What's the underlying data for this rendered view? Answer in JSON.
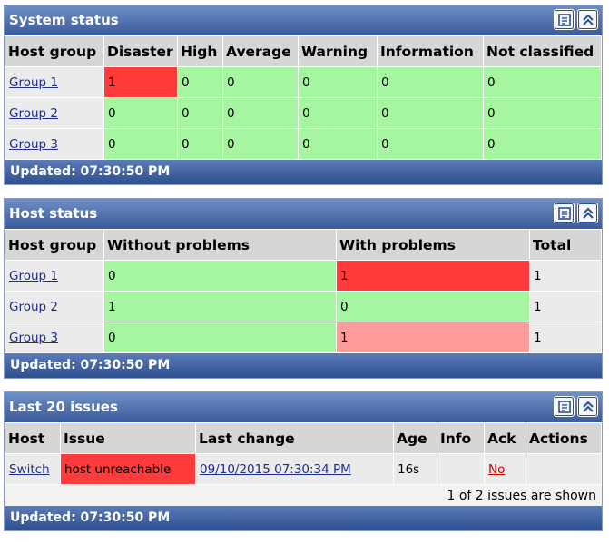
{
  "colors": {
    "ok": "#a6f5a0",
    "problem": "#ff3b3b",
    "problem_light": "#ff9c9c",
    "header_bar": "#3a5a9b"
  },
  "icons": {
    "menu": "list-icon",
    "collapse": "collapse-up-icon"
  },
  "system_status": {
    "title": "System status",
    "columns": [
      "Host group",
      "Disaster",
      "High",
      "Average",
      "Warning",
      "Information",
      "Not classified"
    ],
    "rows": [
      {
        "group": "Group  1",
        "values": [
          "1",
          "0",
          "0",
          "0",
          "0",
          "0"
        ]
      },
      {
        "group": "Group  2",
        "values": [
          "0",
          "0",
          "0",
          "0",
          "0",
          "0"
        ]
      },
      {
        "group": "Group  3",
        "values": [
          "0",
          "0",
          "0",
          "0",
          "0",
          "0"
        ]
      }
    ],
    "updated": "Updated: 07:30:50 PM"
  },
  "host_status": {
    "title": "Host status",
    "columns": [
      "Host group",
      "Without problems",
      "With problems",
      "Total"
    ],
    "rows": [
      {
        "group": "Group  1",
        "without": "0",
        "with": "1",
        "total": "1"
      },
      {
        "group": "Group  2",
        "without": "1",
        "with": "0",
        "total": "1"
      },
      {
        "group": "Group  3",
        "without": "0",
        "with": "1",
        "total": "1"
      }
    ],
    "updated": "Updated: 07:30:50 PM"
  },
  "last_issues": {
    "title": "Last 20 issues",
    "columns": [
      "Host",
      "Issue",
      "Last change",
      "Age",
      "Info",
      "Ack",
      "Actions"
    ],
    "rows": [
      {
        "host": "Switch",
        "issue": "host unreachable",
        "last_change": "09/10/2015 07:30:34 PM",
        "age": "16s",
        "info": "",
        "ack": "No",
        "actions": ""
      }
    ],
    "shown": "1 of 2 issues are shown",
    "updated": "Updated: 07:30:50 PM"
  }
}
